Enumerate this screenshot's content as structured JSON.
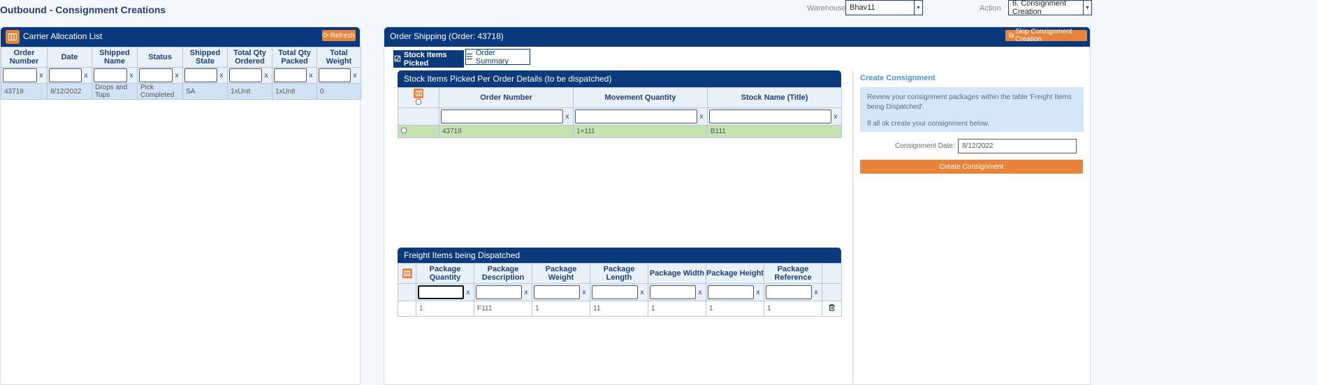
{
  "page": {
    "title": "Outbound - Consignment Creations"
  },
  "header": {
    "warehouse_label": "Warehouse",
    "warehouse_value": "Bhav11",
    "action_label": "Action",
    "action_value": "6. Consignment Creation"
  },
  "carrier": {
    "title": "Carrier Allocation List",
    "refresh_label": "Refresh",
    "columns": [
      "Order Number",
      "Date",
      "Shipped Name",
      "Status",
      "Shipped State",
      "Total Qty Ordered",
      "Total Qty Packed",
      "Total Weight"
    ],
    "filter_clear": "x",
    "rows": [
      [
        "43718",
        "8/12/2022",
        "Drops and Tops",
        "Pick Completed",
        "SA",
        "1xUnit",
        "1xUnit",
        "0"
      ]
    ]
  },
  "shipping": {
    "title": "Order Shipping (Order: 43718)",
    "skip_label": "Skip Consignment Creation",
    "tabs": [
      {
        "label": "Stock Items Picked",
        "active": true
      },
      {
        "label": "Order Summary",
        "active": false
      }
    ],
    "stock": {
      "title": "Stock Items Picked Per Order Details (to be dispatched)",
      "columns": [
        "Order Number",
        "Movement Quantity",
        "Stock Name (Title)"
      ],
      "rows": [
        [
          "43718",
          "1×111",
          "B111"
        ]
      ]
    },
    "freight": {
      "title": "Freight Items being Dispatched",
      "columns": [
        "Package Quantity",
        "Package Description",
        "Package Weight",
        "Package Length",
        "Package Width",
        "Package Height",
        "Package Reference"
      ],
      "rows": [
        [
          "1",
          "F111",
          "1",
          "11",
          "1",
          "1",
          "1"
        ]
      ]
    },
    "create": {
      "title": "Create Consignment",
      "info_line1": "Review your consignment packages within the table 'Freight Items being Dispatched'.",
      "info_line2": "If all ok create your consignment below.",
      "date_label": "Consignment Date:",
      "date_value": "8/12/2022",
      "button_label": "Create Consignment"
    }
  },
  "colors": {
    "navy": "#0b3a7c",
    "orange": "#e8833a",
    "selected_row": "#d2e2f5",
    "green_row": "#c5e3b1"
  }
}
